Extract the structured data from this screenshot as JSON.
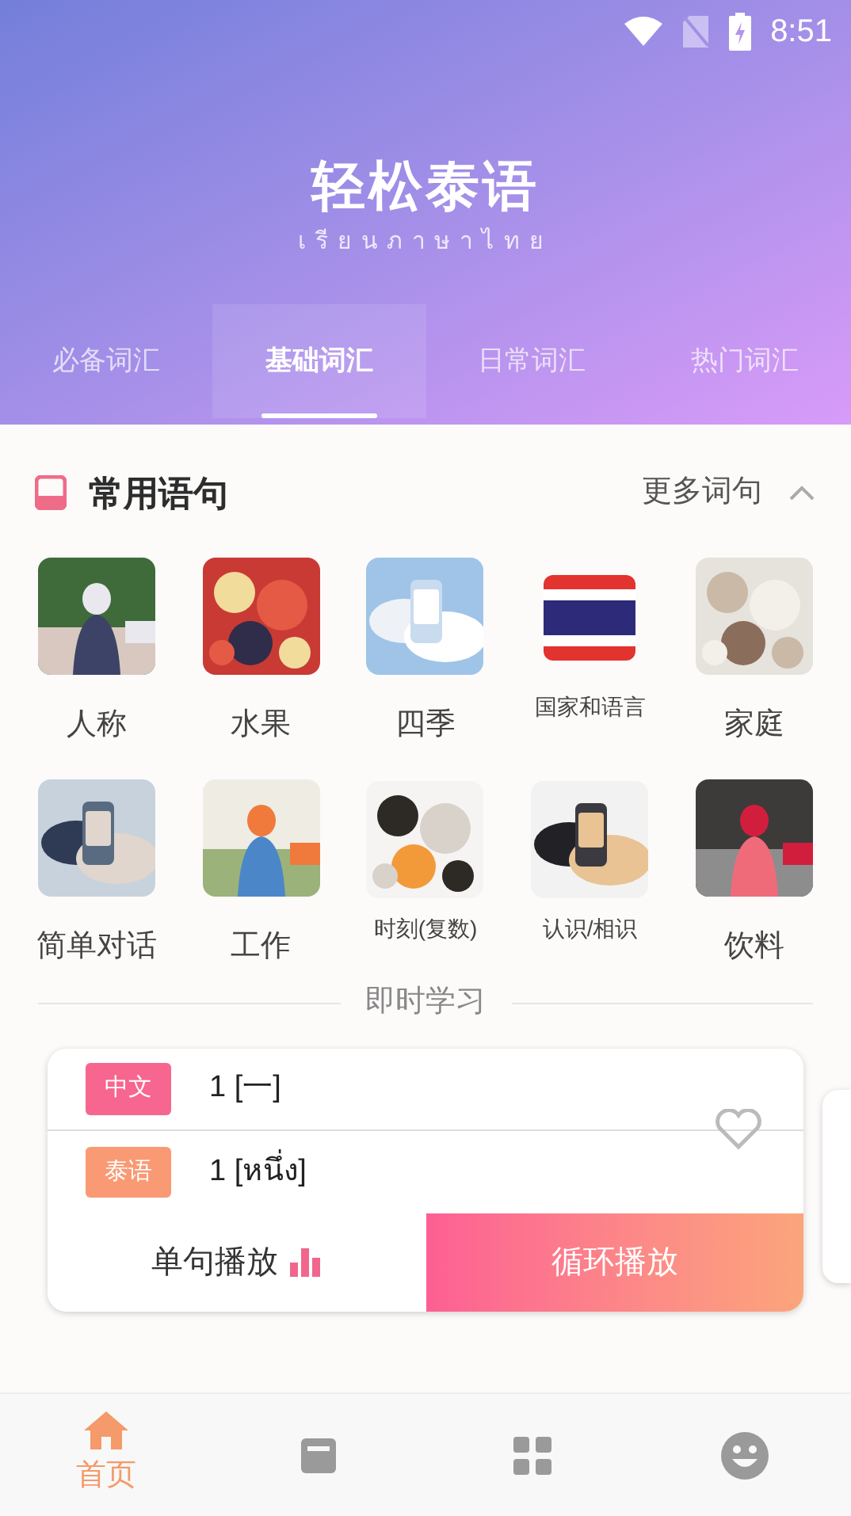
{
  "status_bar": {
    "time": "8:51"
  },
  "header": {
    "title": "轻松泰语",
    "subtitle": "เรียนภาษาไทย"
  },
  "tabs": [
    {
      "label": "必备词汇",
      "selected": false
    },
    {
      "label": "基础词汇",
      "selected": true
    },
    {
      "label": "日常词汇",
      "selected": false
    },
    {
      "label": "热门词汇",
      "selected": false
    }
  ],
  "section": {
    "title": "常用语句",
    "more": "更多词句",
    "expanded": true
  },
  "categories": [
    {
      "label": "人称",
      "kind": "picture"
    },
    {
      "label": "水果",
      "kind": "picture"
    },
    {
      "label": "四季",
      "kind": "picture"
    },
    {
      "label": "国家和语言",
      "kind": "flag"
    },
    {
      "label": "家庭",
      "kind": "picture"
    },
    {
      "label": "简单对话",
      "kind": "picture"
    },
    {
      "label": "工作",
      "kind": "picture"
    },
    {
      "label": "时刻(复数)",
      "kind": "picture"
    },
    {
      "label": "认识/相识",
      "kind": "picture"
    },
    {
      "label": "饮料",
      "kind": "picture"
    }
  ],
  "study": {
    "heading": "即时学习",
    "rows": [
      {
        "tag": "中文",
        "text": "1 [一]",
        "color": "#f7668e"
      },
      {
        "tag": "泰语",
        "text": "1 [หนึ่ง]",
        "color": "#f99a74"
      }
    ],
    "favorite": false,
    "buttons": [
      {
        "label": "单句播放",
        "selected": false
      },
      {
        "label": "循环播放",
        "selected": true
      }
    ]
  },
  "nav": [
    {
      "label": "首页",
      "kind": "home",
      "selected": true
    },
    {
      "kind": "book",
      "selected": false
    },
    {
      "kind": "grid",
      "selected": false
    },
    {
      "kind": "smile",
      "selected": false
    }
  ]
}
